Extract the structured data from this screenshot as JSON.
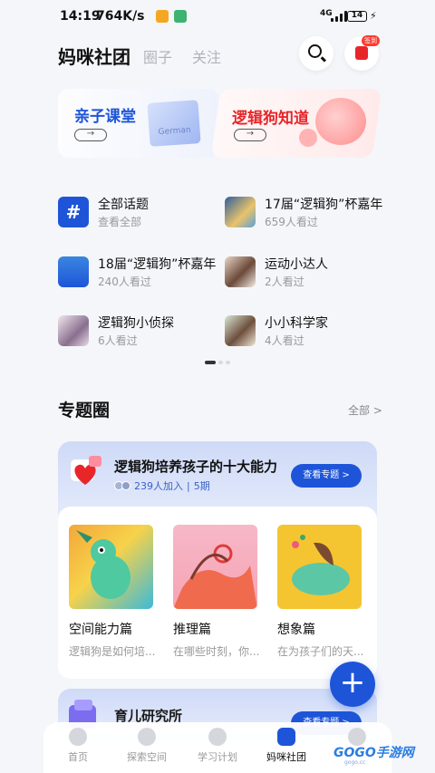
{
  "status": {
    "time": "14:19",
    "speed": "764K/s",
    "network": "4G",
    "battery": "14"
  },
  "header": {
    "title": "妈咪社团",
    "tabs": [
      "圈子",
      "关注"
    ],
    "sign_badge": "签到"
  },
  "banners": [
    {
      "title": "亲子课堂",
      "arrow": "→",
      "book_text": "German",
      "color": "#1e55d8"
    },
    {
      "title": "逻辑狗知道",
      "arrow": "→",
      "color": "#e8262a"
    }
  ],
  "topics": [
    {
      "name": "全部话题",
      "sub": "查看全部",
      "icon": "hash-icon",
      "glyph": "#"
    },
    {
      "name": "17届“逻辑狗”杯嘉年",
      "sub": "659人看过",
      "icon": "event-thumbnail"
    },
    {
      "name": "18届“逻辑狗”杯嘉年",
      "sub": "240人看过",
      "icon": "event-thumbnail"
    },
    {
      "name": "运动小达人",
      "sub": "2人看过",
      "icon": "photo-thumbnail"
    },
    {
      "name": "逻辑狗小侦探",
      "sub": "6人看过",
      "icon": "photo-thumbnail"
    },
    {
      "name": "小小科学家",
      "sub": "4人看过",
      "icon": "photo-thumbnail"
    }
  ],
  "section": {
    "title": "专题圈",
    "all": "全部 >"
  },
  "featured": {
    "title": "逻辑狗培养孩子的十大能力",
    "members": "239人加入",
    "separator": "|",
    "periods": "5期",
    "button": "查看专题 >",
    "items": [
      {
        "name": "空间能力篇",
        "desc": "逻辑狗是如何培..."
      },
      {
        "name": "推理篇",
        "desc": "在哪些时刻，你..."
      },
      {
        "name": "想象篇",
        "desc": "在为孩子们的天..."
      }
    ]
  },
  "second": {
    "title": "育儿研究所",
    "button": "查看专题 >"
  },
  "fab": "+",
  "tabbar": [
    {
      "label": "首页",
      "icon": "home-icon"
    },
    {
      "label": "探索空间",
      "icon": "planet-icon"
    },
    {
      "label": "学习计划",
      "icon": "robot-icon"
    },
    {
      "label": "妈咪社团",
      "icon": "community-icon",
      "active": true
    },
    {
      "label": "",
      "icon": "profile-icon"
    }
  ],
  "watermark": {
    "text": "GOGO手游网",
    "sub": "gogo.cc"
  },
  "colors": {
    "accent": "#1e55d8",
    "red": "#e8262a",
    "bg": "#f5f6fa"
  }
}
